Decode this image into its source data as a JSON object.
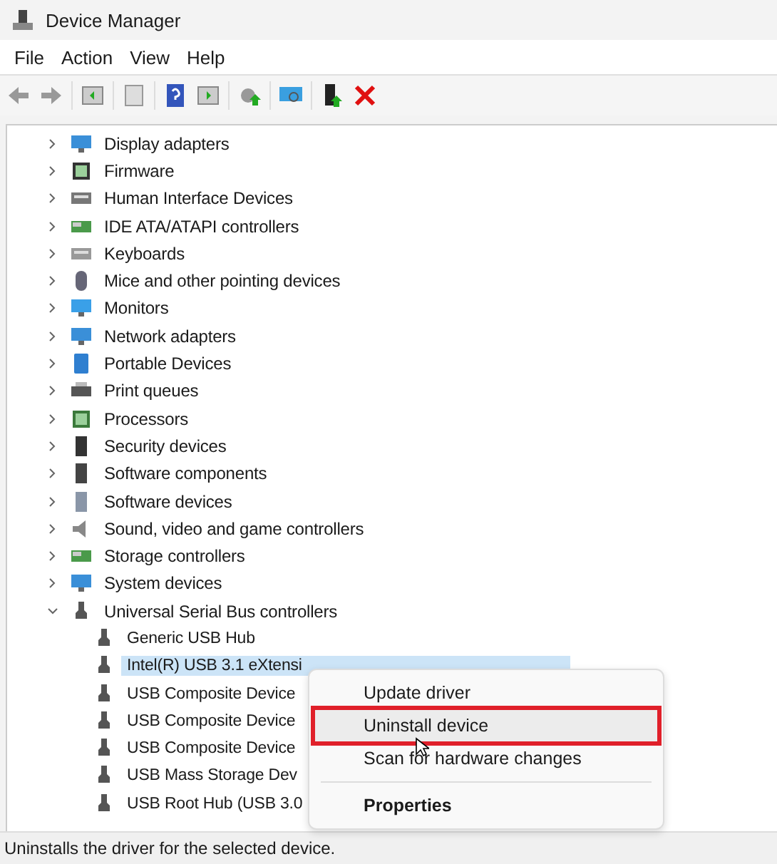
{
  "window": {
    "title": "Device Manager"
  },
  "menu_bar": [
    "File",
    "Action",
    "View",
    "Help"
  ],
  "tree": [
    {
      "label": "Display adapters",
      "expanded": false
    },
    {
      "label": "Firmware",
      "expanded": false
    },
    {
      "label": "Human Interface Devices",
      "expanded": false
    },
    {
      "label": "IDE ATA/ATAPI controllers",
      "expanded": false
    },
    {
      "label": "Keyboards",
      "expanded": false
    },
    {
      "label": "Mice and other pointing devices",
      "expanded": false
    },
    {
      "label": "Monitors",
      "expanded": false
    },
    {
      "label": "Network adapters",
      "expanded": false
    },
    {
      "label": "Portable Devices",
      "expanded": false
    },
    {
      "label": "Print queues",
      "expanded": false
    },
    {
      "label": "Processors",
      "expanded": false
    },
    {
      "label": "Security devices",
      "expanded": false
    },
    {
      "label": "Software components",
      "expanded": false
    },
    {
      "label": "Software devices",
      "expanded": false
    },
    {
      "label": "Sound, video and game controllers",
      "expanded": false
    },
    {
      "label": "Storage controllers",
      "expanded": false
    },
    {
      "label": "System devices",
      "expanded": false
    },
    {
      "label": "Universal Serial Bus controllers",
      "expanded": true,
      "children": [
        {
          "label": "Generic USB Hub",
          "selected": false
        },
        {
          "label": "Intel(R) USB 3.1 eXtensi",
          "selected": true
        },
        {
          "label": "USB Composite Device",
          "selected": false
        },
        {
          "label": "USB Composite Device",
          "selected": false
        },
        {
          "label": "USB Composite Device",
          "selected": false
        },
        {
          "label": "USB Mass Storage Dev",
          "selected": false
        },
        {
          "label": "USB Root Hub (USB 3.0",
          "selected": false
        }
      ]
    }
  ],
  "context_menu": [
    {
      "label": "Update driver",
      "selected": false,
      "bold": false,
      "separator_before": false
    },
    {
      "label": "Uninstall device",
      "selected": true,
      "bold": false,
      "separator_before": false
    },
    {
      "label": "Scan for hardware changes",
      "selected": false,
      "bold": false,
      "separator_before": false
    },
    {
      "label": "Properties",
      "selected": false,
      "bold": true,
      "separator_before": true
    }
  ],
  "status_bar": "Uninstalls the driver for the selected device."
}
